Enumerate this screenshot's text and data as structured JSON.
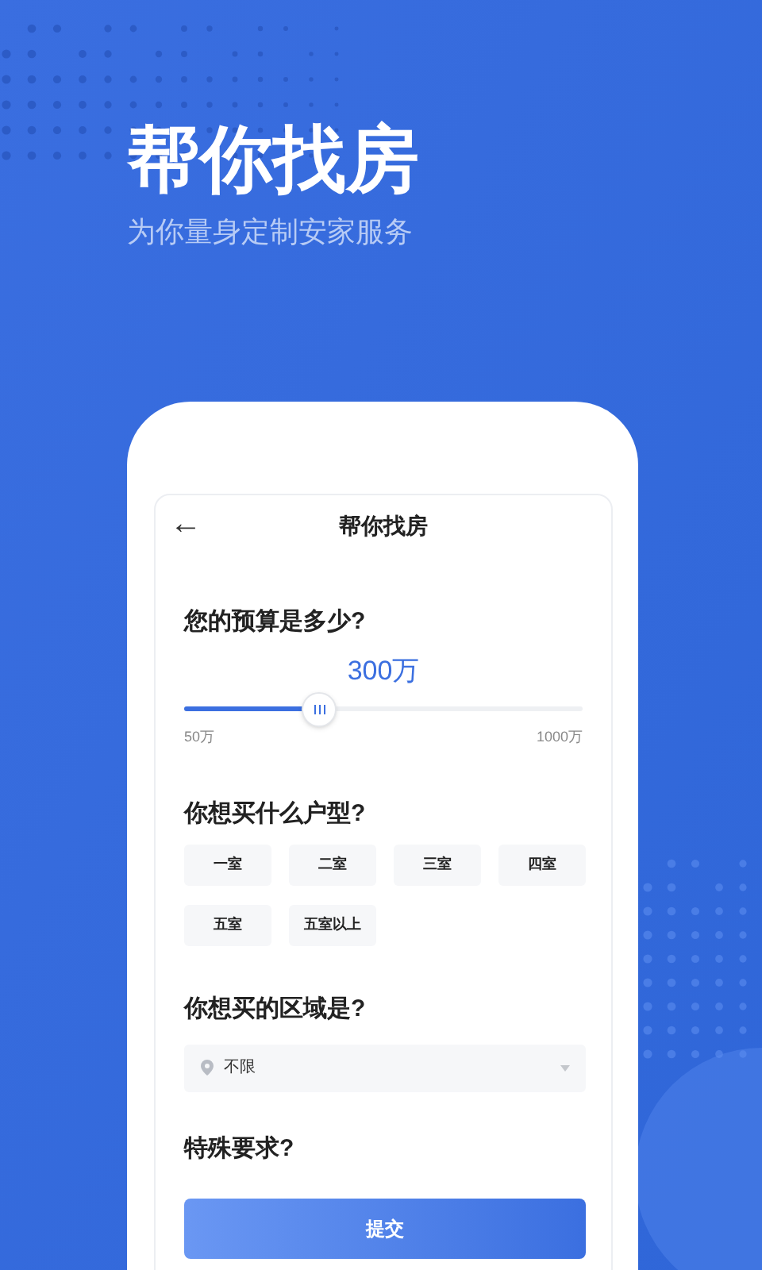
{
  "hero": {
    "title": "帮你找房",
    "subtitle": "为你量身定制安家服务"
  },
  "card": {
    "back": "←",
    "title": "帮你找房"
  },
  "budget": {
    "question": "您的预算是多少?",
    "value": "300万",
    "level": 0.34,
    "min": "50万",
    "max": "1000万"
  },
  "room_type": {
    "question": "你想买什么户型?",
    "options": [
      {
        "label": "一室",
        "selected": false
      },
      {
        "label": "二室",
        "selected": false
      },
      {
        "label": "三室",
        "selected": false
      },
      {
        "label": "四室",
        "selected": false
      },
      {
        "label": "五室",
        "selected": false
      },
      {
        "label": "五室以上",
        "selected": false
      }
    ]
  },
  "area": {
    "question": "你想买的区域是?",
    "value": "不限"
  },
  "special": {
    "question": "特殊要求?"
  },
  "submit": "提交"
}
